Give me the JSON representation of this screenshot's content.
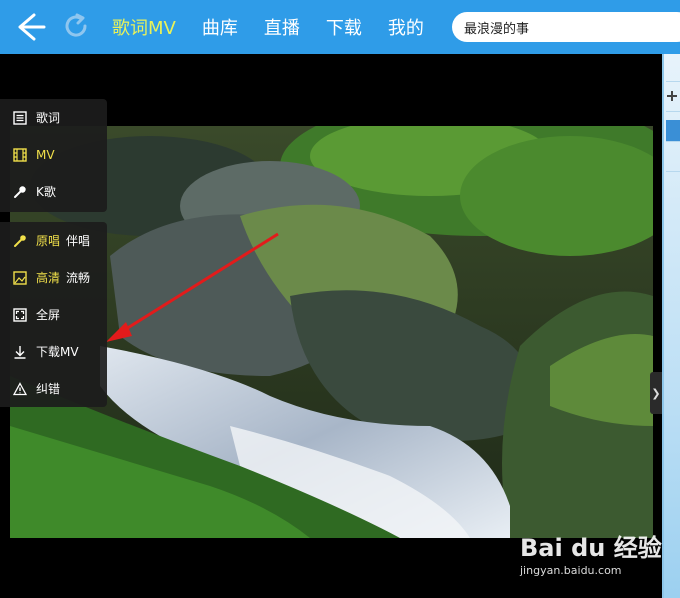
{
  "header": {
    "nav": [
      "歌词MV",
      "曲库",
      "直播",
      "下载",
      "我的"
    ],
    "search_value": "最浪漫的事"
  },
  "side_menu": {
    "group1": [
      {
        "label": "歌词",
        "icon": "lyrics-icon"
      },
      {
        "label": "MV",
        "icon": "film-icon",
        "highlighted": true
      },
      {
        "label": "K歌",
        "icon": "microphone-icon"
      }
    ],
    "group2": [
      {
        "label": "原唱",
        "label2": "伴唱",
        "icon": "vocal-switch-icon"
      },
      {
        "label": "高清",
        "label2": "流畅",
        "icon": "quality-icon"
      },
      {
        "label": "全屏",
        "icon": "fullscreen-icon"
      },
      {
        "label": "下载MV",
        "icon": "download-icon"
      },
      {
        "label": "纠错",
        "icon": "warning-icon"
      }
    ]
  },
  "watermark": {
    "brand": "Bai du 经验",
    "url": "jingyan.baidu.com"
  },
  "colors": {
    "topbar": "#2f9ce8",
    "active_nav": "#e9f25a",
    "menu_highlight": "#f1e04a",
    "annotation_arrow": "#e21b1b"
  }
}
